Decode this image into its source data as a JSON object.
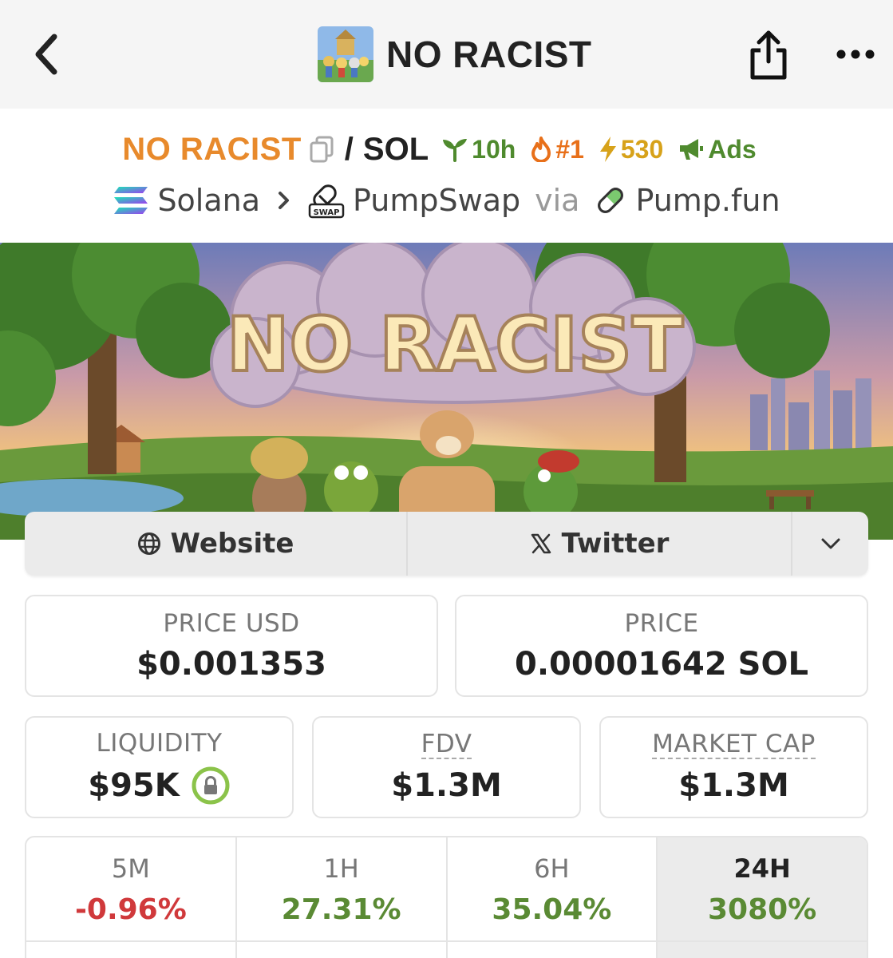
{
  "nav": {
    "title": "NO RACIST",
    "back_icon": "chevron-left-icon",
    "share_icon": "share-icon",
    "more_icon": "more-horizontal-icon"
  },
  "pair": {
    "base": "NO RACIST",
    "separator": "/",
    "quote": "SOL",
    "age": "10h",
    "rank": "#1",
    "boosts": "530",
    "ads": "Ads",
    "colors": {
      "base": "#e88a2c",
      "green": "#4f8a2e",
      "orange": "#e8701a",
      "gold": "#d7a21a"
    }
  },
  "chain": {
    "network": "Solana",
    "dex": "PumpSwap",
    "dex_badge": "SWAP",
    "via": "via",
    "launchpad": "Pump.fun"
  },
  "banner": {
    "text": "NO RACIST"
  },
  "links": {
    "website": "Website",
    "twitter": "Twitter"
  },
  "stats": {
    "price_usd_label": "PRICE USD",
    "price_usd": "$0.001353",
    "price_label": "PRICE",
    "price": "0.00001642 SOL",
    "liquidity_label": "LIQUIDITY",
    "liquidity": "$95K",
    "fdv_label": "FDV",
    "fdv": "$1.3M",
    "mcap_label": "MARKET CAP",
    "mcap": "$1.3M"
  },
  "changes": [
    {
      "label": "5M",
      "value": "-0.96%"
    },
    {
      "label": "1H",
      "value": "27.31%"
    },
    {
      "label": "6H",
      "value": "35.04%"
    },
    {
      "label": "24H",
      "value": "3080%"
    }
  ]
}
